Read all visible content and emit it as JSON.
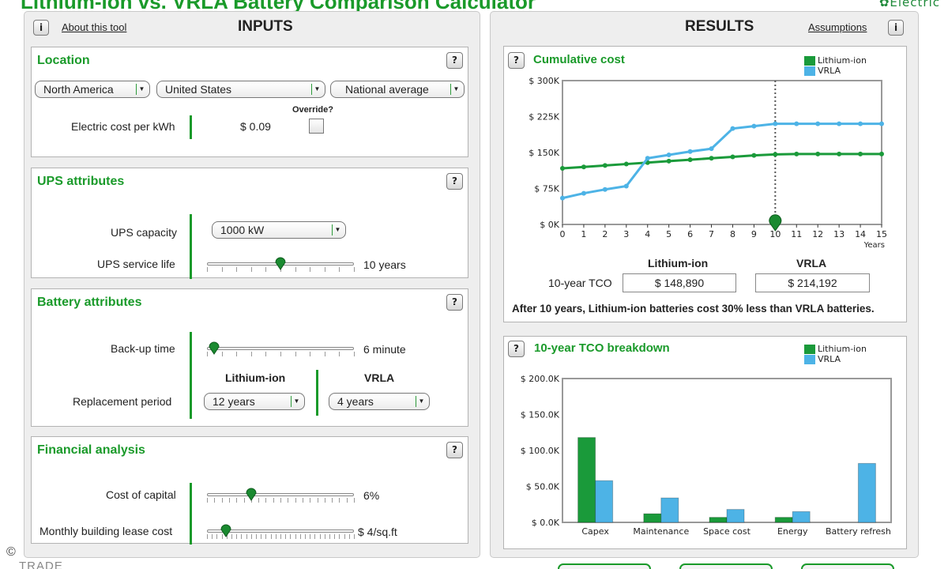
{
  "app": {
    "title": "Lithium-ion vs. VRLA Battery Comparison Calculator",
    "brand": "Electric",
    "copyright": "©",
    "footer": "TRADE"
  },
  "inputs": {
    "about_link": "About this tool",
    "title": "INPUTS",
    "location": {
      "title": "Location",
      "region": "North America",
      "country": "United States",
      "area": "National average",
      "override_label": "Override?",
      "override_checked": false,
      "electric_cost_label": "Electric cost per kWh",
      "electric_cost_value": "$  0.09"
    },
    "ups": {
      "title": "UPS attributes",
      "capacity_label": "UPS capacity",
      "capacity_value": "1000 kW",
      "service_life_label": "UPS service life",
      "service_life_value": "10 years",
      "service_life_fraction": 0.5
    },
    "battery": {
      "title": "Battery attributes",
      "backup_label": "Back-up time",
      "backup_value": "6 minute",
      "backup_fraction": 0.05,
      "col_li": "Lithium-ion",
      "col_vrla": "VRLA",
      "replacement_label": "Replacement period",
      "li_period": "12 years",
      "vrla_period": "4 years"
    },
    "financial": {
      "title": "Financial analysis",
      "capital_label": "Cost of capital",
      "capital_value": "6%",
      "capital_fraction": 0.3,
      "lease_label": "Monthly building lease cost",
      "lease_value": "$ 4/sq.ft",
      "lease_fraction": 0.13
    }
  },
  "results": {
    "title": "RESULTS",
    "assumptions_link": "Assumptions",
    "summary": {
      "li_label": "Lithium-ion",
      "vrla_label": "VRLA",
      "tco_label": "10-year TCO",
      "li_tco": "$ 148,890",
      "vrla_tco": "$ 214,192",
      "conclusion": "After 10 years,  Lithium-ion batteries cost 30% less than VRLA batteries."
    }
  },
  "colors": {
    "lithium": "#1a9a3a",
    "vrla": "#4db3e6",
    "accent": "#1a9a2a"
  },
  "icons": {
    "info": "i",
    "help": "?"
  },
  "chart_data": [
    {
      "type": "line",
      "title": "Cumulative cost",
      "x": [
        0,
        1,
        2,
        3,
        4,
        5,
        6,
        7,
        8,
        9,
        10,
        11,
        12,
        13,
        14,
        15
      ],
      "xlabel": "Years",
      "ylabel": "",
      "ylim": [
        0,
        300000
      ],
      "yticks": [
        "$ 0K",
        "$ 75K",
        "$ 150K",
        "$ 225K",
        "$ 300K"
      ],
      "yvalues": [
        0,
        75000,
        150000,
        225000,
        300000
      ],
      "marker_year": 10,
      "series": [
        {
          "name": "Lithium-ion",
          "values": [
            117000,
            120000,
            123000,
            126000,
            129000,
            132000,
            135000,
            138000,
            141000,
            144000,
            146000,
            147000,
            147000,
            147000,
            147000,
            147000
          ]
        },
        {
          "name": "VRLA",
          "values": [
            55000,
            65000,
            73000,
            80000,
            138000,
            145000,
            152000,
            158000,
            200000,
            205000,
            210000,
            210000,
            210000,
            210000,
            210000,
            210000
          ]
        }
      ],
      "legend": "top-right",
      "grid": false
    },
    {
      "type": "bar",
      "title": "10-year TCO breakdown",
      "categories": [
        "Capex",
        "Maintenance",
        "Space cost",
        "Energy",
        "Battery refresh"
      ],
      "ylim": [
        0,
        200000
      ],
      "yticks": [
        "$ 0.0K",
        "$ 50.0K",
        "$ 100.0K",
        "$ 150.0K",
        "$ 200.0K"
      ],
      "yvalues": [
        0,
        50000,
        100000,
        150000,
        200000
      ],
      "series": [
        {
          "name": "Lithium-ion",
          "values": [
            118000,
            12000,
            7000,
            7000,
            0
          ]
        },
        {
          "name": "VRLA",
          "values": [
            58000,
            34000,
            18000,
            15000,
            82000
          ]
        }
      ],
      "legend": "top-right",
      "grid": false
    }
  ]
}
